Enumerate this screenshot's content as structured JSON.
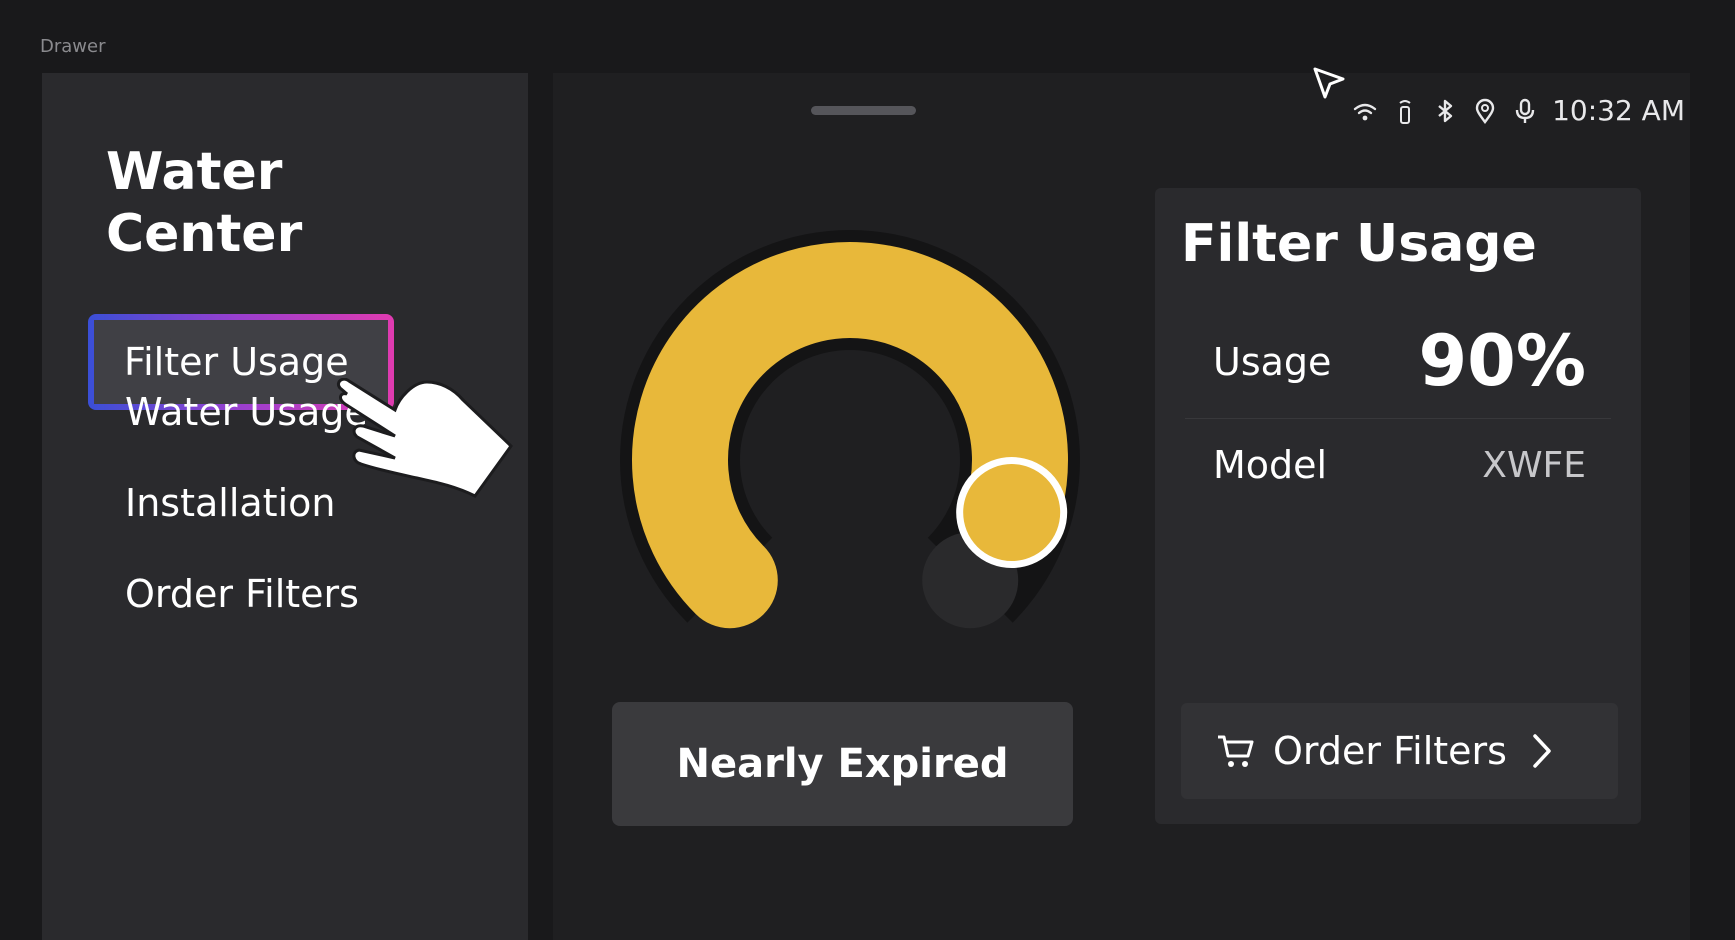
{
  "window": {
    "label": "Drawer"
  },
  "sidebar": {
    "title_line1": "Water",
    "title_line2": "Center",
    "items": [
      {
        "label": "Filter Usage",
        "active": true
      },
      {
        "label": "Water Usage",
        "active": false
      },
      {
        "label": "Installation",
        "active": false
      },
      {
        "label": "Order Filters",
        "active": false
      }
    ]
  },
  "status_bar": {
    "time": "10:32 AM",
    "icons": [
      "wifi-icon",
      "remote-icon",
      "bluetooth-icon",
      "location-icon",
      "microphone-icon"
    ]
  },
  "gauge": {
    "usage_percent": 90,
    "fill_color": "#e8b83a",
    "status_label": "Nearly Expired"
  },
  "filter_card": {
    "title": "Filter Usage",
    "usage_label": "Usage",
    "usage_value": "90%",
    "model_label": "Model",
    "model_value": "XWFE",
    "order_button_label": "Order Filters"
  },
  "colors": {
    "accent_gradient_start": "#3a4fd6",
    "accent_gradient_mid": "#9b3fcf",
    "accent_gradient_end": "#e03bb0",
    "gauge_yellow": "#e8b83a"
  }
}
